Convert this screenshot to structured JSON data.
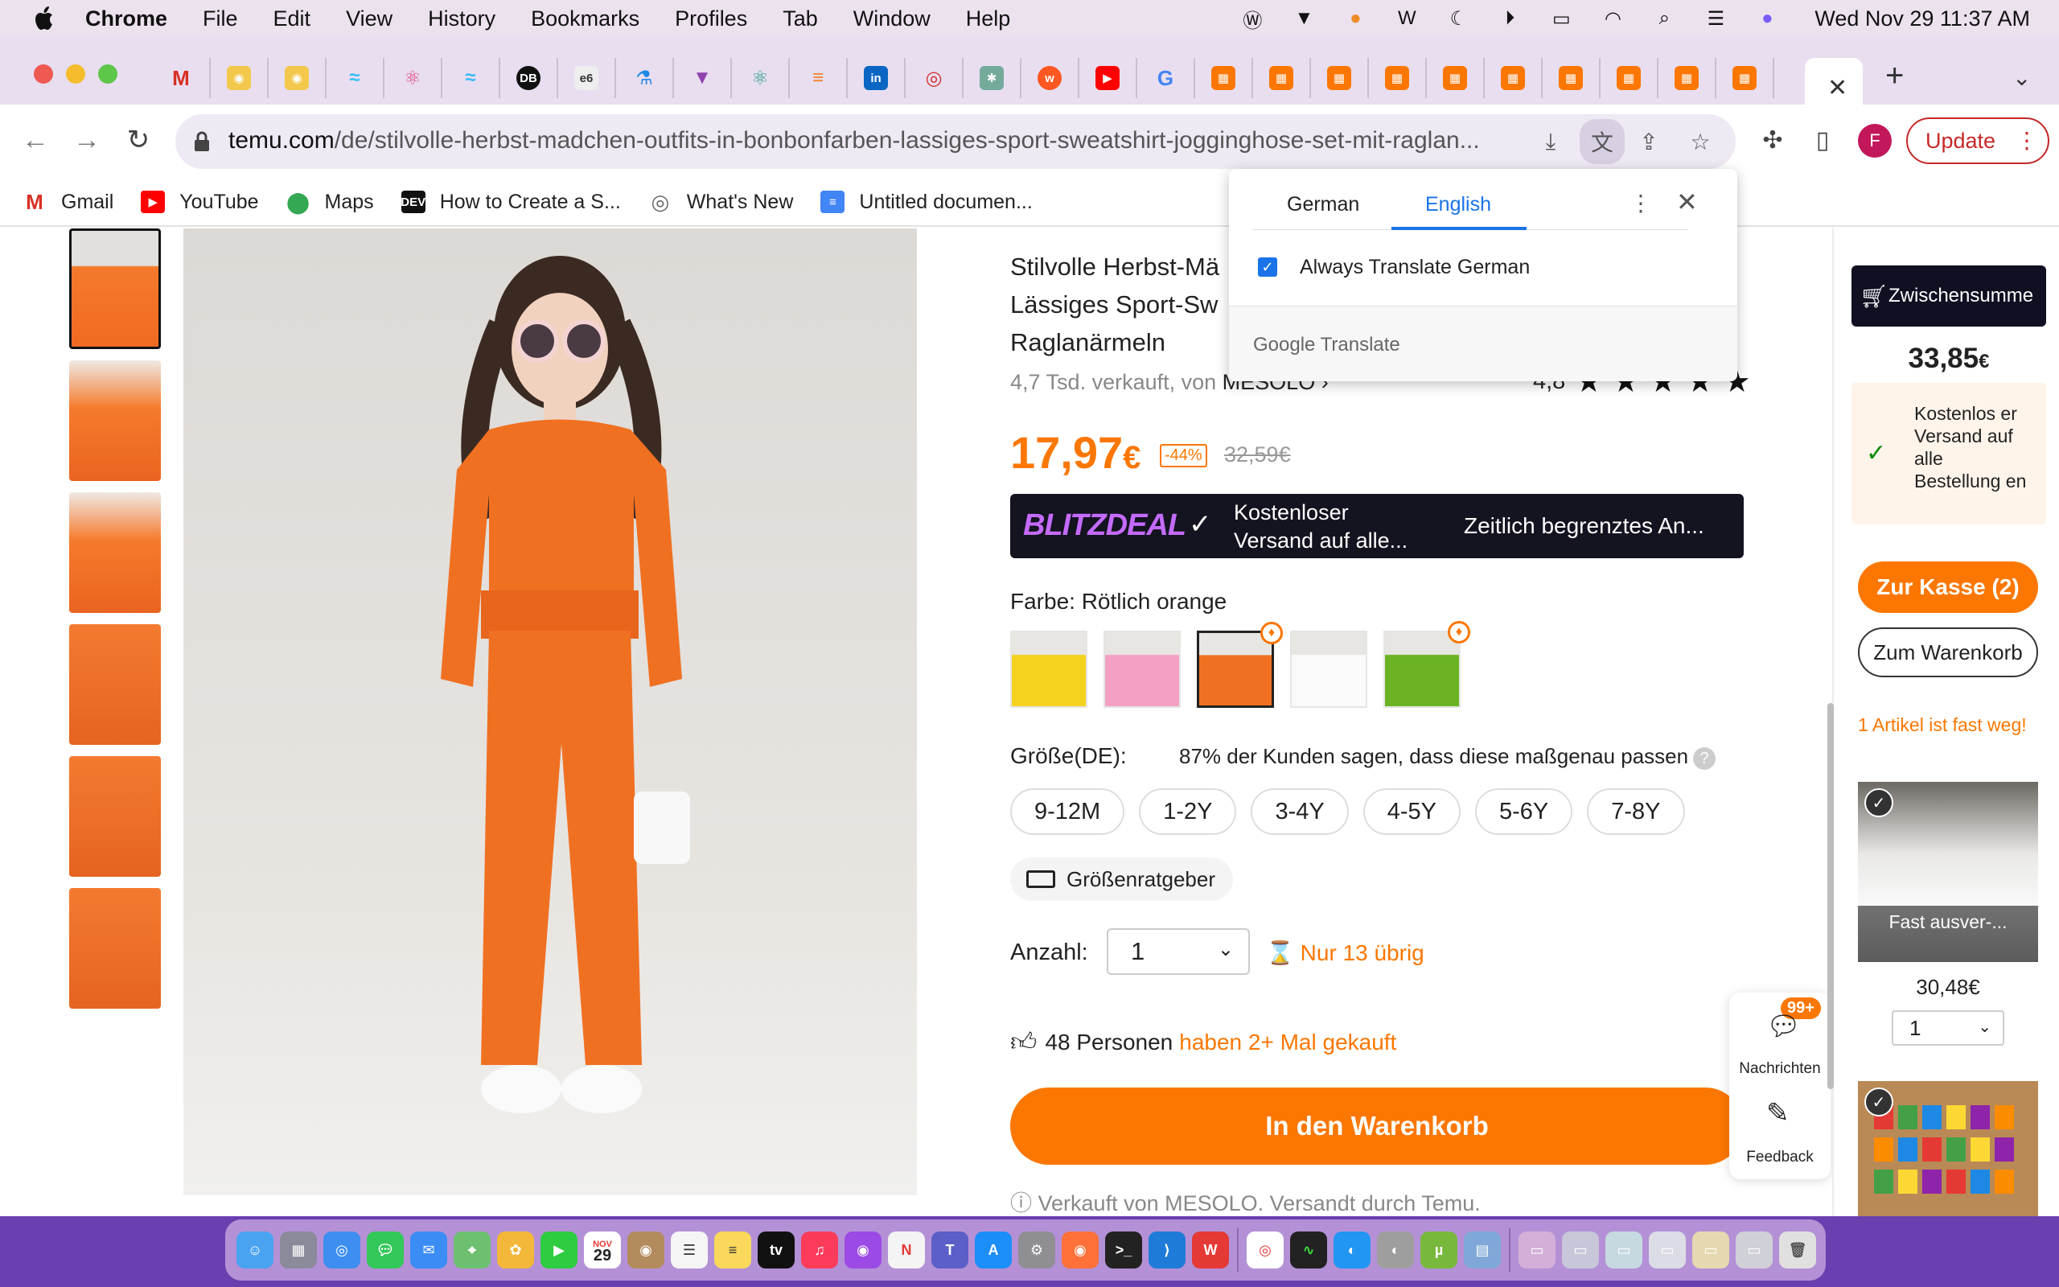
{
  "menubar": {
    "app": "Chrome",
    "items": [
      "File",
      "Edit",
      "View",
      "History",
      "Bookmarks",
      "Profiles",
      "Tab",
      "Window",
      "Help"
    ],
    "clock": "Wed Nov 29  11:37 AM"
  },
  "toolbar": {
    "url_domain": "temu.com",
    "url_path": "/de/stilvolle-herbst-madchen-outfits-in-bonbonfarben-lassiges-sport-sweatshirt-jogginghose-set-mit-raglan...",
    "profile_initial": "F",
    "update_label": "Update"
  },
  "bookmarks": [
    {
      "label": "Gmail",
      "icon": "gmail-icon"
    },
    {
      "label": "YouTube",
      "icon": "youtube-icon"
    },
    {
      "label": "Maps",
      "icon": "maps-icon"
    },
    {
      "label": "How to Create a S...",
      "icon": "dev-icon"
    },
    {
      "label": "What's New",
      "icon": "chrome-icon"
    },
    {
      "label": "Untitled documen...",
      "icon": "docs-icon"
    }
  ],
  "translate_popup": {
    "source_lang": "German",
    "target_lang": "English",
    "always_label": "Always Translate German",
    "footer": "Google Translate"
  },
  "product": {
    "title": "Stilvolle Herbst-Mä... Lässiges Sport-Sw... Raglanärmeln",
    "title_line1": "Stilvolle Herbst-Mä",
    "title_line2": "Lässiges Sport-Sw",
    "title_line3": "Raglanärmeln",
    "sold_text": "4,7 Tsd. verkauft, von",
    "seller": "MESOLO",
    "rating": "4,8",
    "price_main": "17,97",
    "price_currency": "€",
    "discount": "-44%",
    "old_price": "32,59€",
    "blitz_logo": "BLITZDEAL",
    "blitz_ship_1": "Kostenloser",
    "blitz_ship_2": "Versand auf alle...",
    "blitz_limited": "Zeitlich begrenztes An...",
    "color_label": "Farbe: Rötlich orange",
    "size_label": "Größe(DE):",
    "size_note": "87% der Kunden sagen, dass diese maßgenau passen",
    "sizes": [
      "9-12M",
      "1-2Y",
      "3-4Y",
      "4-5Y",
      "5-6Y",
      "7-8Y"
    ],
    "size_guide": "Größenratgeber",
    "qty_label": "Anzahl:",
    "qty_value": "1",
    "stock_note": "Nur 13 übrig",
    "bought_count": "48 Personen",
    "bought_note": "haben 2+ Mal gekauft",
    "add_to_cart": "In den Warenkorb",
    "sold_by": "Verkauft von MESOLO. Versandt durch Temu."
  },
  "float_widget": {
    "badge": "99+",
    "messages": "Nachrichten",
    "feedback": "Feedback"
  },
  "cart": {
    "subtotal_label": "Zwischensumme",
    "total_main": "33,85",
    "total_currency": "€",
    "free_shipping": "Kostenlos er Versand auf alle Bestellung en",
    "checkout": "Zur Kasse (2)",
    "to_cart": "Zum Warenkorb",
    "almost_gone": "1 Artikel ist fast weg!",
    "item1_overlay": "Fast ausver-...",
    "item1_price": "30,48€",
    "item1_qty": "1"
  },
  "dock_calendar": {
    "month": "NOV",
    "day": "29"
  },
  "colors": {
    "accent": "#fb7701",
    "translate_blue": "#1a73e8",
    "update_red": "#c62828"
  }
}
